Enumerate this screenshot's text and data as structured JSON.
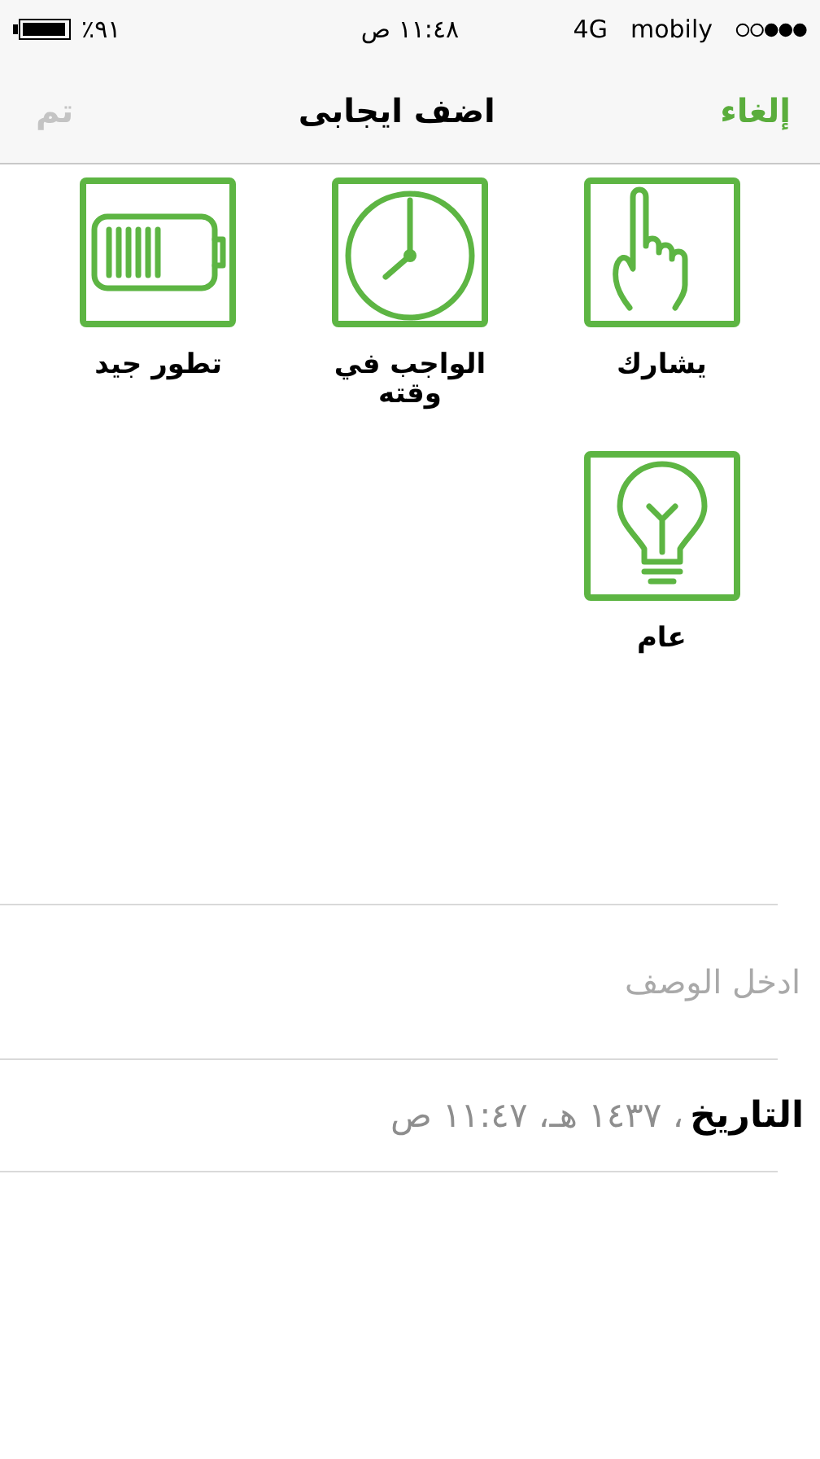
{
  "status_bar": {
    "carrier": "mobily",
    "network": "4G",
    "time": "١١:٤٨ ص",
    "battery": "٪٩١"
  },
  "nav_bar": {
    "cancel": {
      "label": "إلغاء",
      "disabled": false
    },
    "title": "اضف ايجابى",
    "done": {
      "label": "تم",
      "disabled": true
    }
  },
  "categories": [
    {
      "kind": "hand",
      "label": "يشارك"
    },
    {
      "kind": "clock",
      "label": "الواجب في وقته"
    },
    {
      "kind": "battery",
      "label": "تطور جيد"
    },
    {
      "kind": "bulb",
      "label": "عام"
    }
  ],
  "description": {
    "placeholder": "ادخل الوصف"
  },
  "date_row": {
    "label": "التاريخ",
    "value": "، ١٤٣٧ هـ، ١١:٤٧ ص"
  }
}
